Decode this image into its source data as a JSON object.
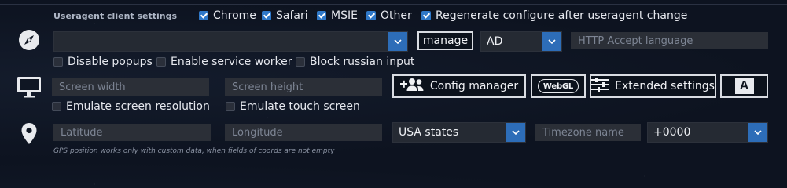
{
  "useragent": {
    "section_label": "Useragent client settings",
    "browsers": [
      {
        "label": "Chrome",
        "checked": true
      },
      {
        "label": "Safari",
        "checked": true
      },
      {
        "label": "MSIE",
        "checked": true
      },
      {
        "label": "Other",
        "checked": true
      }
    ],
    "regenerate_label": "Regenerate configure after useragent change",
    "regenerate_checked": true,
    "useragent_select_value": "",
    "manage_label": "manage",
    "language_select_value": "AD",
    "accept_language_placeholder": "HTTP Accept language",
    "disable_popups_label": "Disable popups",
    "disable_popups_checked": false,
    "service_worker_label": "Enable service worker",
    "service_worker_checked": false,
    "block_russian_label": "Block russian input",
    "block_russian_checked": false
  },
  "screen": {
    "width_placeholder": "Screen width",
    "height_placeholder": "Screen height",
    "config_manager_label": "Config manager",
    "webgl_label": "WebGL",
    "extended_settings_label": "Extended settings",
    "font_button_label": "A",
    "emulate_resolution_label": "Emulate screen resolution",
    "emulate_resolution_checked": false,
    "emulate_touch_label": "Emulate touch screen",
    "emulate_touch_checked": false
  },
  "geo": {
    "latitude_placeholder": "Latitude",
    "longitude_placeholder": "Longitude",
    "region_select_value": "USA states",
    "timezone_placeholder": "Timezone name",
    "offset_select_value": "+0000",
    "hint": "GPS position works only with custom data, when fields of coords are not empty"
  },
  "icons": {
    "compass": "compass-icon",
    "monitor": "monitor-icon",
    "location": "location-pin-icon",
    "add_users": "add-users-icon",
    "sliders": "sliders-icon"
  },
  "colors": {
    "accent_blue": "#2d6db8",
    "checkbox_blue": "#2f78c8",
    "field_bg": "#2b2f37",
    "background": "#0f1623"
  }
}
